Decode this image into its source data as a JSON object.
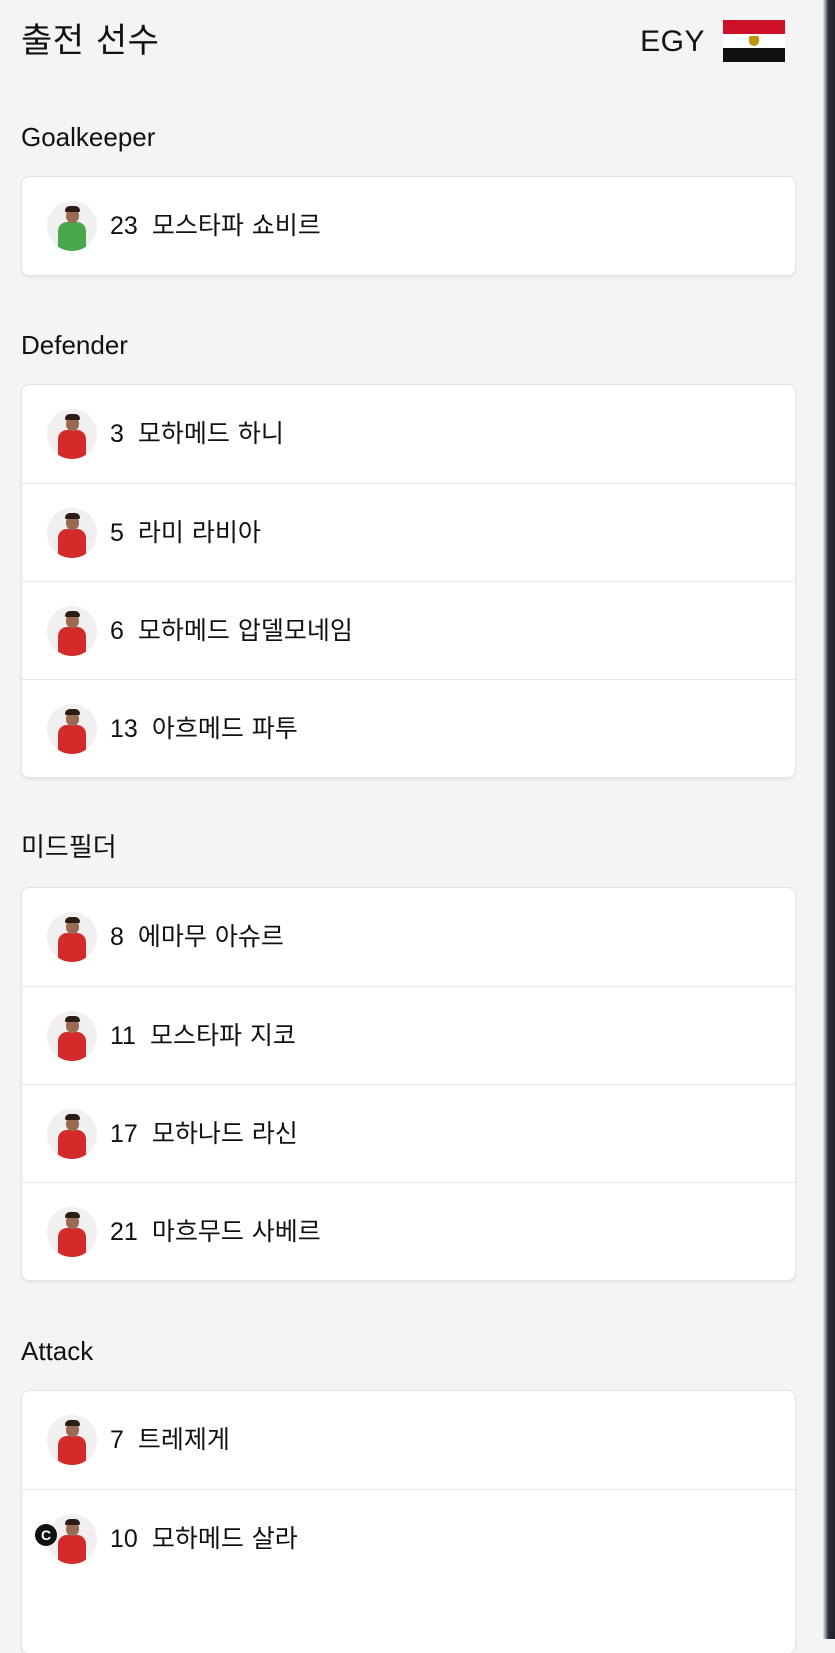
{
  "header": {
    "title": "출전 선수",
    "team_code": "EGY",
    "flag": {
      "colors": [
        "#ce1126",
        "#ffffff",
        "#111111"
      ],
      "emblem_color": "#c09300",
      "icon": "egypt-flag-icon"
    }
  },
  "colors": {
    "gk_kit": "#4aa84c",
    "outfield_kit": "#d42a2a",
    "captain_badge": "#111111"
  },
  "sections": [
    {
      "title": "Goalkeeper",
      "players": [
        {
          "number": "23",
          "name": "모스타파 쇼비르"
        }
      ]
    },
    {
      "title": "Defender",
      "players": [
        {
          "number": "3",
          "name": "모하메드 하니"
        },
        {
          "number": "5",
          "name": "라미 라비아"
        },
        {
          "number": "6",
          "name": "모하메드 압델모네임"
        },
        {
          "number": "13",
          "name": "아흐메드 파투"
        }
      ]
    },
    {
      "title": "미드필더",
      "players": [
        {
          "number": "8",
          "name": "에마무 아슈르"
        },
        {
          "number": "11",
          "name": "모스타파 지코"
        },
        {
          "number": "17",
          "name": "모하나드 라신"
        },
        {
          "number": "21",
          "name": "마흐무드 사베르"
        }
      ]
    },
    {
      "title": "Attack",
      "players": [
        {
          "number": "7",
          "name": "트레제게"
        },
        {
          "number": "10",
          "name": "모하메드 살라",
          "captain_badge": "C"
        }
      ]
    }
  ]
}
